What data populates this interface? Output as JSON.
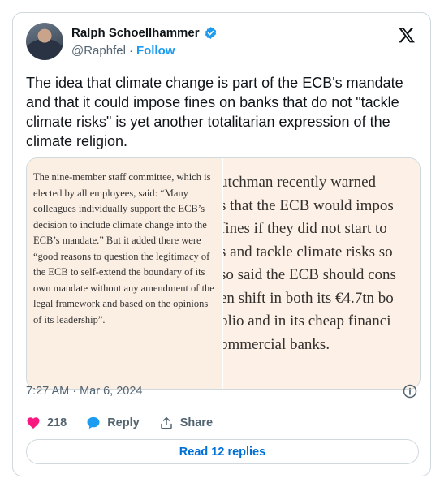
{
  "author": {
    "name": "Ralph Schoellhammer",
    "handle": "@Raphfel",
    "separator": "·",
    "follow_label": "Follow"
  },
  "tweet": {
    "text": "The idea that climate change is part of the ECB's mandate and that it could impose fines on banks that do not \"tackle climate risks\" is yet another totalitarian expression of the climate religion."
  },
  "media": {
    "left_text": "The nine-member staff committee, which is elected by all employees, said: “Many colleagues individually support the ECB’s decision to include climate change into the ECB’s mandate.” But it added there were “good reasons to question the legitimacy of the ECB to self-extend the boundary of its own mandate without any amendment of the legal framework and based on the opinions of its leadership”.",
    "right_lines": [
      "utchman recently warned",
      "s that the ECB would impos",
      "fines if they did not start to",
      "s and tackle climate risks so",
      "so said the ECB should cons",
      "en shift in both its €4.7tn bo",
      "olio and in its cheap financi",
      "ommercial banks."
    ]
  },
  "timestamp": "7:27 AM · Mar 6, 2024",
  "actions": {
    "like_count": "218",
    "reply_label": "Reply",
    "share_label": "Share"
  },
  "read_replies_label": "Read 12 replies",
  "colors": {
    "accent": "#1d9bf0",
    "like": "#f91880",
    "muted": "#536471",
    "media_bg": "#fdf1e7"
  },
  "icons": [
    "verified-badge-icon",
    "x-logo-icon",
    "info-icon",
    "heart-icon",
    "reply-bubble-icon",
    "share-upload-icon"
  ]
}
